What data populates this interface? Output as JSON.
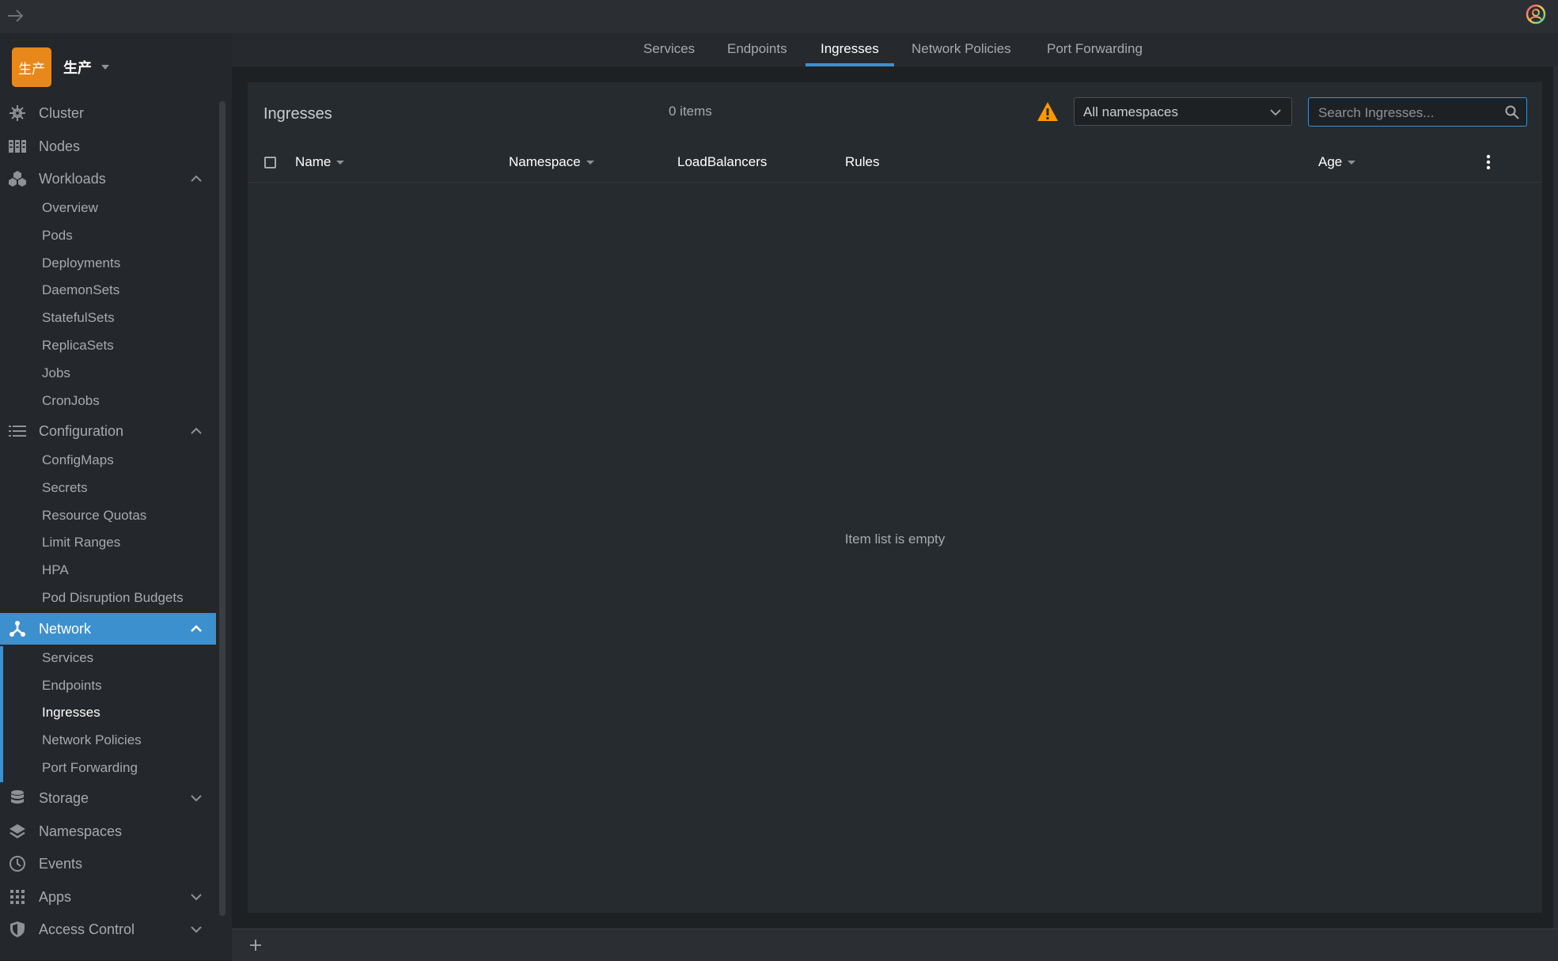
{
  "workspace": {
    "avatar_text": "生产",
    "name": "生产"
  },
  "sidebar": {
    "cluster": "Cluster",
    "nodes": "Nodes",
    "workloads": {
      "label": "Workloads",
      "items": [
        "Overview",
        "Pods",
        "Deployments",
        "DaemonSets",
        "StatefulSets",
        "ReplicaSets",
        "Jobs",
        "CronJobs"
      ]
    },
    "configuration": {
      "label": "Configuration",
      "items": [
        "ConfigMaps",
        "Secrets",
        "Resource Quotas",
        "Limit Ranges",
        "HPA",
        "Pod Disruption Budgets"
      ]
    },
    "network": {
      "label": "Network",
      "items": [
        "Services",
        "Endpoints",
        "Ingresses",
        "Network Policies",
        "Port Forwarding"
      ],
      "current": "Ingresses"
    },
    "storage": "Storage",
    "namespaces": "Namespaces",
    "events": "Events",
    "apps": "Apps",
    "access_control": "Access Control"
  },
  "tabs": [
    "Services",
    "Endpoints",
    "Ingresses",
    "Network Policies",
    "Port Forwarding"
  ],
  "active_tab": "Ingresses",
  "panel": {
    "title": "Ingresses",
    "count": "0 items",
    "namespace_select": "All namespaces",
    "search_placeholder": "Search Ingresses...",
    "columns": [
      "Name",
      "Namespace",
      "LoadBalancers",
      "Rules",
      "Age"
    ],
    "empty_message": "Item list is empty"
  },
  "colors": {
    "accent": "#3d90ce",
    "warning": "#ff9800",
    "workspace": "#e8881b"
  }
}
